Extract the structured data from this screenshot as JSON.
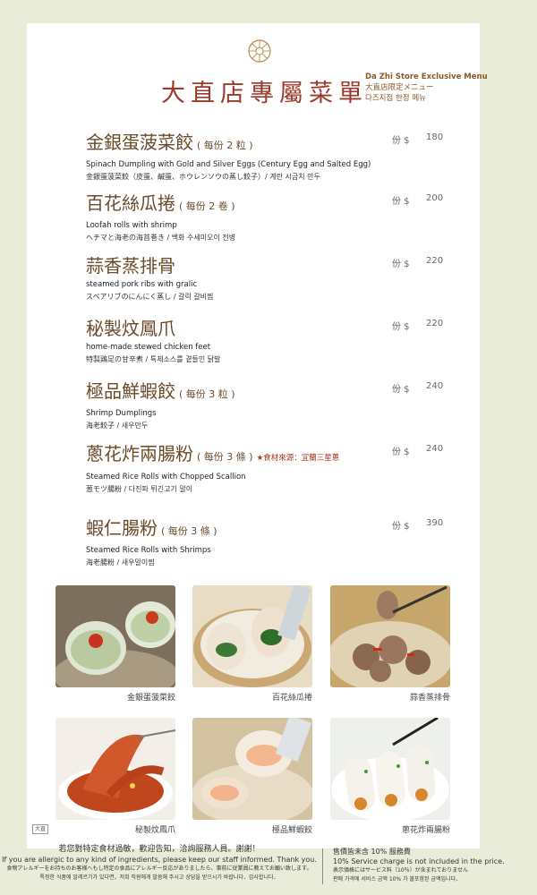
{
  "header": {
    "title": "大直店專屬菜單",
    "subtitle_en": "Da Zhi Store Exclusive Menu",
    "subtitle_jp": "大直店限定メニュー",
    "subtitle_kr": "다즈지점 한정 메뉴",
    "logo_icon": "dim-sum-basket-logo-icon"
  },
  "price_unit": "份 $",
  "items": [
    {
      "name": "金銀蛋菠菜餃",
      "qty": "( 每份 2 粒 )",
      "source": "",
      "en": "Spinach Dumpling with Gold and Silver Eggs (Century Egg and Salted Egg)",
      "jp_kr": "金銀蛋菠菜餃（皮蛋、鹹蛋、ホウレンソウの蒸し餃子）/ 계란 시금치 만두",
      "price": "180"
    },
    {
      "name": "百花絲瓜捲",
      "qty": "( 每份 2 卷 )",
      "source": "",
      "en": "Loofah rolls with shrimp",
      "jp_kr": "ヘチマと海老の海苔巻き / 백화 수세미오이 전병",
      "price": "200"
    },
    {
      "name": "蒜香蒸排骨",
      "qty": "",
      "source": "",
      "en": "steamed pork ribs with gralic",
      "jp_kr": "スペアリブのにんにく蒸し / 갈릭 갈비찜",
      "price": "220"
    },
    {
      "name": "秘製炆鳳爪",
      "qty": "",
      "source": "",
      "en": "home-made stewed chicken feet",
      "jp_kr": "特製鶏足の甘辛煮 / 특제소스를 곁들인 닭발",
      "price": "220"
    },
    {
      "name": "極品鮮蝦餃",
      "qty": "( 每份 3 粒 )",
      "source": "",
      "en": "Shrimp Dumplings",
      "jp_kr": "海老餃子 / 새우만두",
      "price": "240"
    },
    {
      "name": "蔥花炸兩腸粉",
      "qty": "( 每份 3 條 )",
      "source": "★食材來源：宜蘭三星蔥",
      "en": "Steamed Rice Rolls with Chopped Scallion",
      "jp_kr": "葱モツ腸粉 / 다진파 튀긴고기 말이",
      "price": "240"
    },
    {
      "name": "蝦仁腸粉",
      "qty": "( 每份 3 條 )",
      "source": "",
      "en": "Steamed Rice Rolls with Shrimps",
      "jp_kr": "海老腸粉 / 새우말이찜",
      "price": "390"
    }
  ],
  "photos": [
    {
      "caption": "金銀蛋菠菜餃",
      "icon": "spinach-dumpling-photo"
    },
    {
      "caption": "百花絲瓜捲",
      "icon": "loofah-roll-photo"
    },
    {
      "caption": "蒜香蒸排骨",
      "icon": "pork-ribs-photo"
    },
    {
      "caption": "秘製炆鳳爪",
      "icon": "chicken-feet-photo"
    },
    {
      "caption": "極品鮮蝦餃",
      "icon": "shrimp-dumpling-photo"
    },
    {
      "caption": "蔥花炸兩腸粉",
      "icon": "rice-roll-photo"
    }
  ],
  "size_tag": "大直",
  "footer": {
    "left": [
      "若您對特定食材過敏，歡迎告知，洽詢服務人員。謝謝！",
      "If you are allergic to any kind of ingredients, please keep our staff informed. Thank you.",
      "食物アレルギーをお持ちのお客様へもし特定の食品にアレルギー反応がありましたら、事前に従業員に教えてお願い致します。",
      "특정한 식품에 알레르기가 있다면，저희 직원에게 말씀해 주시고 상담을 받으시기 바랍니다．감사합니다．"
    ],
    "right": [
      "售價皆未含 10% 服務費",
      "10% Service charge is not included in the price.",
      "表示価格にはサービス料（10％）が含まれておりません",
      "판매 가격에 서비스 금액 10% 가 불포함된 금액입니다．"
    ]
  },
  "colors": {
    "page_bg": "#e9ecd9",
    "title": "#9b3a2a",
    "item_name": "#6b4a2a",
    "accent": "#a8321c"
  }
}
